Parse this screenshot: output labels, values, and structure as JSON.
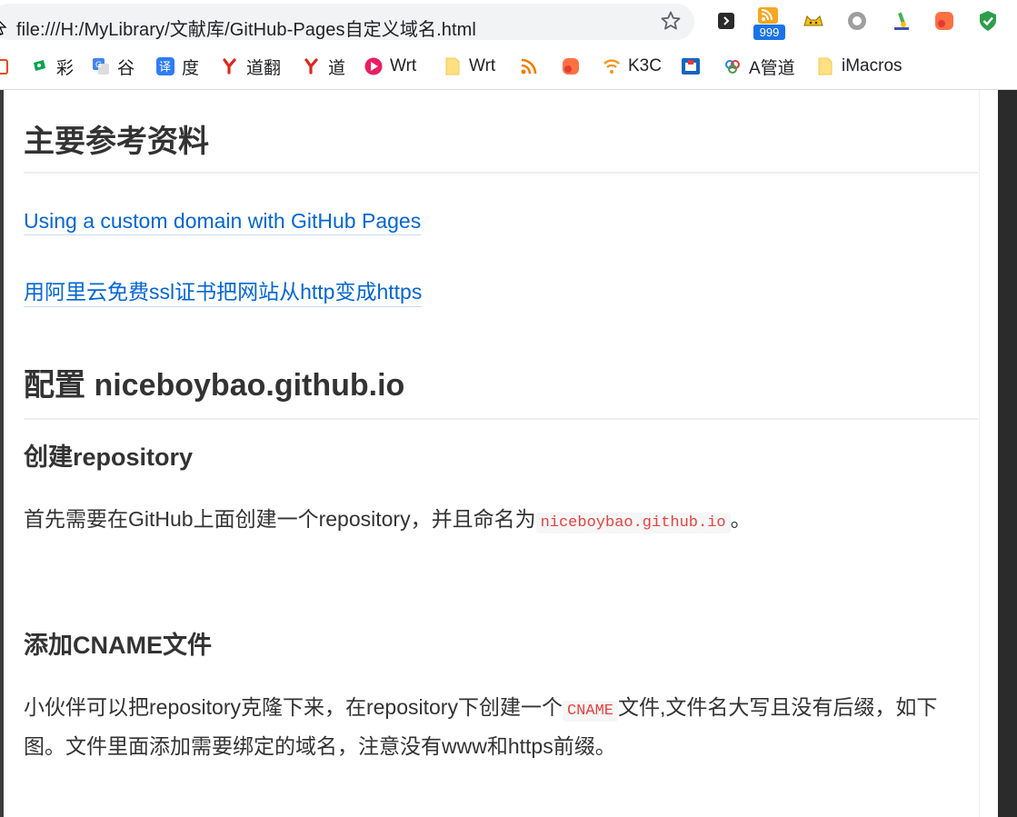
{
  "browser": {
    "url": "file:///H:/MyLibrary/文献库/GitHub-Pages自定义域名.html",
    "extensions": {
      "rss_badge": "999"
    }
  },
  "bookmarks": [
    {
      "label": "彩",
      "icon": "lottery-icon"
    },
    {
      "label": "谷",
      "icon": "google-translate-icon"
    },
    {
      "label": "度",
      "icon": "baidu-translate-icon"
    },
    {
      "label": "道翻",
      "icon": "youdao-icon"
    },
    {
      "label": "道",
      "icon": "youdao-icon"
    },
    {
      "label": "Wrt",
      "icon": "wrt-icon"
    },
    {
      "label": "Wrt",
      "icon": "folder-icon"
    },
    {
      "label": "",
      "icon": "rss-icon"
    },
    {
      "label": "",
      "icon": "bubble-icon"
    },
    {
      "label": "K3C",
      "icon": "wifi-icon"
    },
    {
      "label": "",
      "icon": "app-icon"
    },
    {
      "label": "A管道",
      "icon": "pipeline-icon"
    },
    {
      "label": "iMacros",
      "icon": "folder-icon"
    }
  ],
  "article": {
    "section1_title": "主要参考资料",
    "links": [
      "Using a custom domain with GitHub Pages",
      "用阿里云免费ssl证书把网站从http变成https"
    ],
    "section2_title": "配置 niceboybao.github.io",
    "sub1_title": "创建repository",
    "para1": {
      "before": "首先需要在GitHub上面创建一个repository，并且命名为",
      "code": "niceboybao.github.io",
      "after": "。"
    },
    "sub2_title": "添加CNAME文件",
    "para2": {
      "before": "小伙伴可以把repository克隆下来，在repository下创建一个",
      "code": "CNAME",
      "after": "文件,文件名大写且没有后缀，如下图。文件里面添加需要绑定的域名，注意没有www和https前缀。"
    }
  }
}
